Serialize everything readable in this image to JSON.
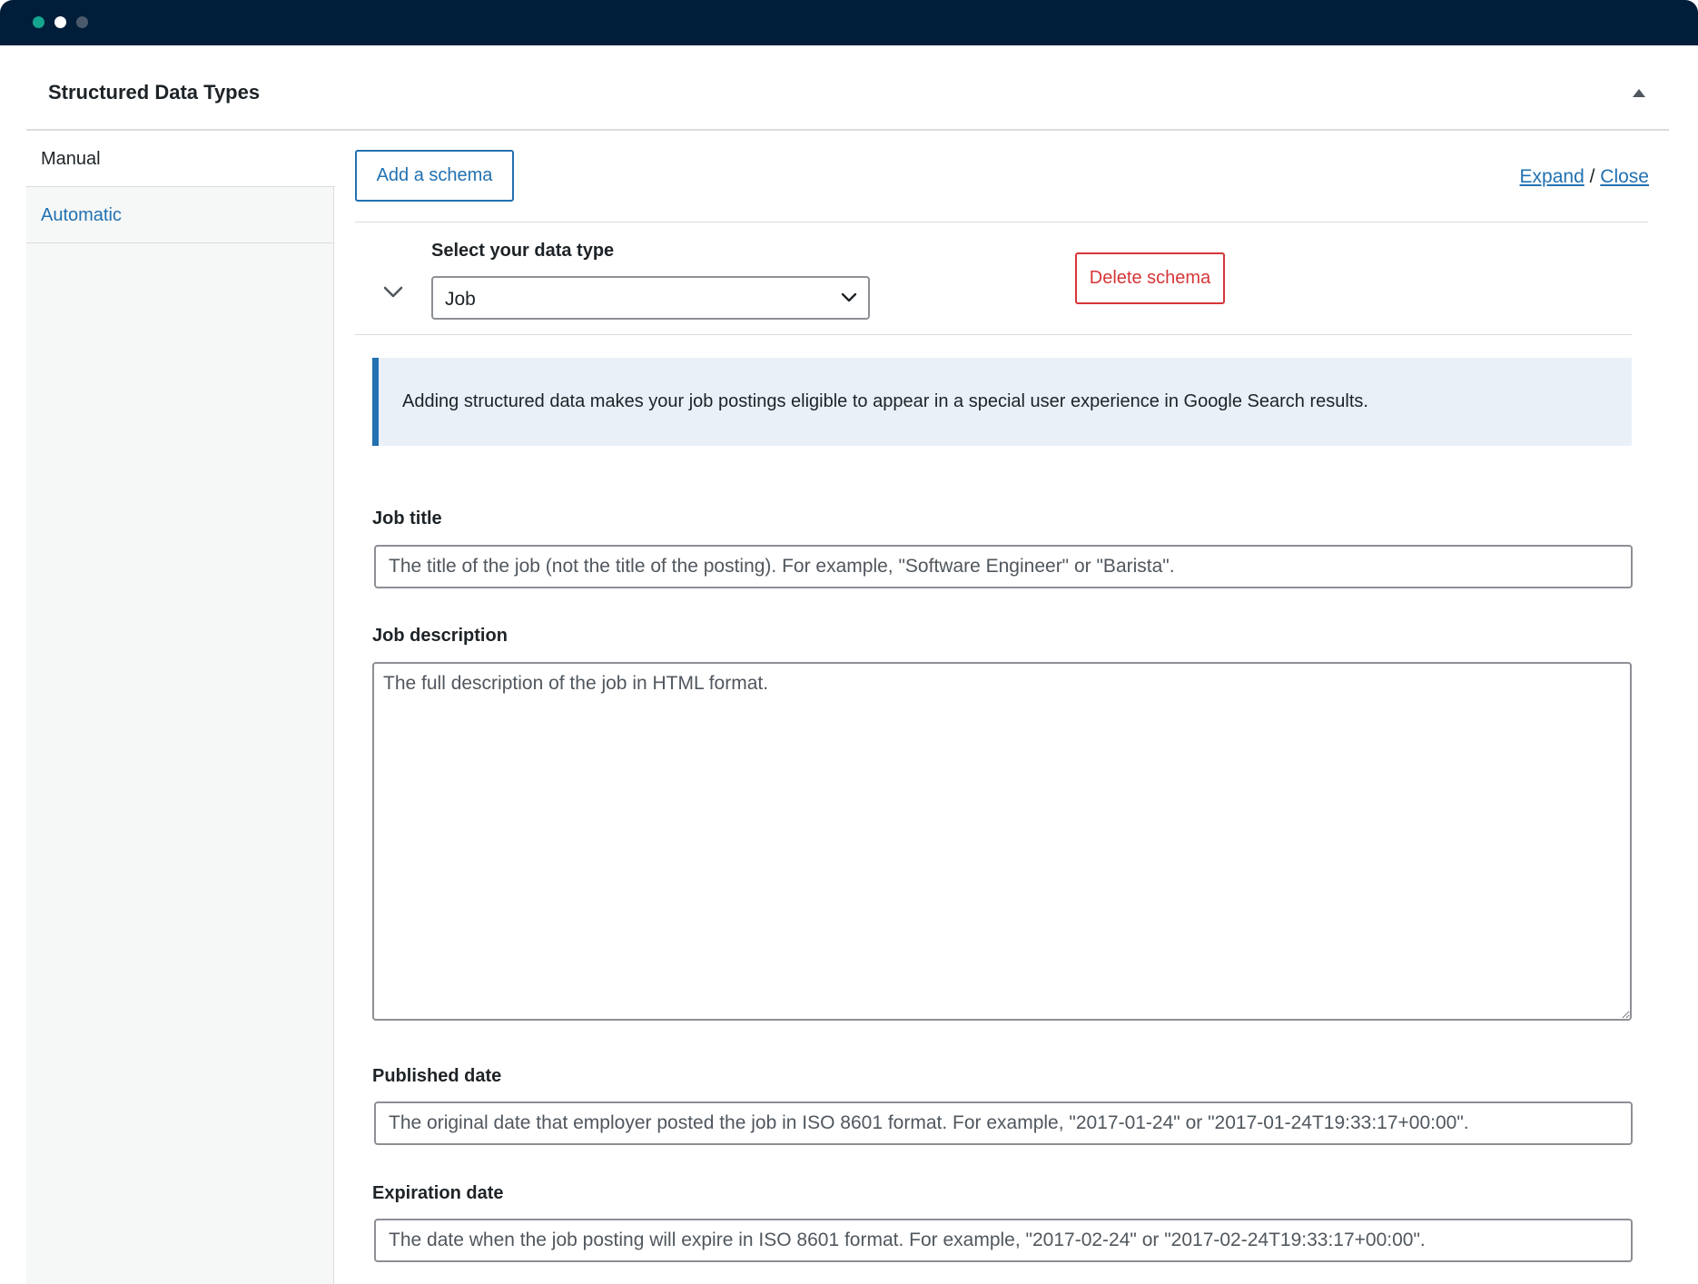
{
  "window": {
    "controls": [
      "close-dot",
      "minimize-dot",
      "maximize-dot"
    ]
  },
  "panel": {
    "title": "Structured Data Types"
  },
  "sidebar": {
    "tabs": [
      {
        "label": "Manual",
        "active": true
      },
      {
        "label": "Automatic",
        "active": false
      }
    ]
  },
  "toolbar": {
    "add_label": "Add a schema",
    "expand_label": "Expand",
    "separator": "/",
    "close_label": "Close"
  },
  "schema": {
    "select_label": "Select your data type",
    "selected_type": "Job",
    "delete_label": "Delete schema"
  },
  "notice": {
    "text": "Adding structured data makes your job postings eligible to appear in a special user experience in Google Search results."
  },
  "fields": {
    "job_title": {
      "label": "Job title",
      "placeholder": "The title of the job (not the title of the posting). For example, \"Software Engineer\" or \"Barista\"."
    },
    "job_description": {
      "label": "Job description",
      "placeholder": "The full description of the job in HTML format."
    },
    "published_date": {
      "label": "Published date",
      "placeholder": "The original date that employer posted the job in ISO 8601 format. For example, \"2017-01-24\" or \"2017-01-24T19:33:17+00:00\"."
    },
    "expiration_date": {
      "label": "Expiration date",
      "placeholder": "The date when the job posting will expire in ISO 8601 format. For example, \"2017-02-24\" or \"2017-02-24T19:33:17+00:00\"."
    }
  },
  "colors": {
    "titlebar": "#001e3a",
    "accent": "#2271b1",
    "danger": "#d63638",
    "notice_bg": "#e9f0f8"
  }
}
